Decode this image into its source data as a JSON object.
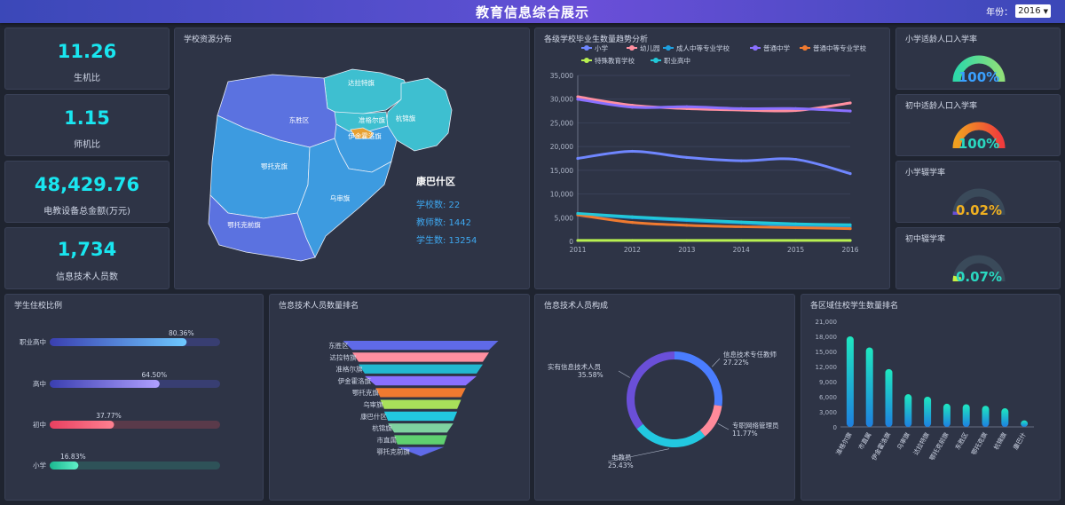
{
  "header": {
    "title": "教育信息综合展示",
    "year_label": "年份：",
    "year_value": "2016"
  },
  "kpis": [
    {
      "value": "11.26",
      "label": "生机比"
    },
    {
      "value": "1.15",
      "label": "师机比"
    },
    {
      "value": "48,429.76",
      "label": "电教设备总金额(万元)"
    },
    {
      "value": "1,734",
      "label": "信息技术人员数"
    }
  ],
  "map": {
    "title": "学校资源分布",
    "regions": [
      "达拉特旗",
      "杭锦旗",
      "东胜区",
      "准格尔旗",
      "伊金霍洛旗",
      "鄂托克旗",
      "乌审旗",
      "鄂托克前旗"
    ],
    "selected": {
      "name": "康巴什区",
      "schools": "学校数: 22",
      "teachers": "教师数: 1442",
      "students": "学生数: 13254"
    },
    "colors": {
      "light": "#3ebfd0",
      "mid": "#3d9be0",
      "dark": "#5b72e0",
      "selected": "#e8a030"
    }
  },
  "gauges": [
    {
      "title": "小学适龄人口入学率",
      "value": "100%",
      "fraction": 1.0,
      "color_start": "#2ed8a8",
      "color_end": "#8fe07a",
      "text_color": "#3aa0ff"
    },
    {
      "title": "初中适龄人口入学率",
      "value": "100%",
      "fraction": 1.0,
      "color_start": "#f0a020",
      "color_end": "#f03c3c",
      "text_color": "#2ad8c0"
    },
    {
      "title": "小学辍学率",
      "value": "0.02%",
      "fraction": 0.02,
      "color_start": "#6a4fd8",
      "color_end": "#6a4fd8",
      "text_color": "#f0b020"
    },
    {
      "title": "初中辍学率",
      "value": "0.07%",
      "fraction": 0.07,
      "color_start": "#c8f040",
      "color_end": "#c8f040",
      "text_color": "#2ad8c0"
    }
  ],
  "chart_data": [
    {
      "type": "line",
      "title": "各级学校毕业生数量趋势分析",
      "x": [
        "2011",
        "2012",
        "2013",
        "2014",
        "2015",
        "2016"
      ],
      "ylim": [
        0,
        35000
      ],
      "yticks": [
        "0",
        "5,000",
        "10,000",
        "15,000",
        "20,000",
        "25,000",
        "30,000",
        "35,000"
      ],
      "series": [
        {
          "name": "小学",
          "color": "#6f86ff",
          "values": [
            17500,
            19000,
            17700,
            17000,
            17300,
            14300
          ]
        },
        {
          "name": "幼儿园",
          "color": "#ff8fa0",
          "values": [
            30500,
            28700,
            28000,
            27700,
            27600,
            29200
          ]
        },
        {
          "name": "成人中等专业学校",
          "color": "#1ea0e0",
          "values": [
            5800,
            5000,
            4400,
            3900,
            3300,
            3100
          ]
        },
        {
          "name": "普通中学",
          "color": "#8a70ff",
          "values": [
            30000,
            28300,
            28400,
            28000,
            28000,
            27500
          ]
        },
        {
          "name": "普通中等专业学校",
          "color": "#f07a30",
          "values": [
            5600,
            4000,
            3400,
            3100,
            2900,
            2700
          ]
        },
        {
          "name": "特殊教育学校",
          "color": "#b8f050",
          "values": [
            200,
            200,
            200,
            200,
            200,
            200
          ]
        },
        {
          "name": "职业高中",
          "color": "#22c8d8",
          "values": [
            5900,
            5200,
            4600,
            4100,
            3700,
            3500
          ]
        }
      ]
    },
    {
      "type": "bar",
      "title": "学生住校比例",
      "categories": [
        "职业高中",
        "高中",
        "初中",
        "小学"
      ],
      "values": [
        80.36,
        64.5,
        37.77,
        16.83
      ],
      "labels": [
        "80.36%",
        "64.50%",
        "37.77%",
        "16.83%"
      ],
      "colors": [
        [
          "#3a3fb0",
          "#6ec8ff"
        ],
        [
          "#3a3fb0",
          "#b0a0ff"
        ],
        [
          "#e84060",
          "#ff8090"
        ],
        [
          "#1ab890",
          "#60f0c8"
        ]
      ],
      "track_colors": [
        "#383e72",
        "#383e72",
        "#5a3a4a",
        "#2e5258"
      ]
    },
    {
      "type": "bar",
      "title": "信息技术人员数量排名",
      "categories": [
        "东胜区",
        "达拉特旗",
        "准格尔旗",
        "伊金霍洛旗",
        "鄂托克旗",
        "乌审旗",
        "康巴什区",
        "杭锦旗",
        "市直属",
        "鄂托克前旗"
      ],
      "values": [
        100,
        88,
        80,
        72,
        58,
        52,
        47,
        42,
        34,
        30
      ],
      "colors": [
        "#5f6ae8",
        "#ff8fa0",
        "#22b8d0",
        "#8a70ff",
        "#f07a30",
        "#a8e05a",
        "#22c8e0",
        "#7fd2a0",
        "#5fd070",
        "#5f6ae8"
      ]
    },
    {
      "type": "pie",
      "title": "信息技术人员构成",
      "slices": [
        {
          "name": "信息技术专任教师",
          "value": 27.22,
          "label": "27.22%",
          "color": "#4a7dff"
        },
        {
          "name": "专职网络管理员",
          "value": 11.77,
          "label": "11.77%",
          "color": "#ff8a9a"
        },
        {
          "name": "电教员",
          "value": 25.43,
          "label": "25.43%",
          "color": "#22c8e0"
        },
        {
          "name": "实有信息技术人员",
          "value": 35.58,
          "label": "35.58%",
          "color": "#6a4fd8"
        }
      ]
    },
    {
      "type": "bar",
      "title": "各区域住校学生数量排名",
      "categories": [
        "准格尔旗",
        "市直属",
        "伊金霍洛旗",
        "乌审旗",
        "达拉特旗",
        "鄂托克前旗",
        "东胜区",
        "鄂托克旗",
        "杭锦旗",
        "康巴什"
      ],
      "values": [
        18000,
        15800,
        11500,
        6500,
        6000,
        4600,
        4500,
        4200,
        3700,
        1300
      ],
      "ylim": [
        0,
        21000
      ],
      "yticks": [
        "0",
        "3,000",
        "6,000",
        "9,000",
        "12,000",
        "15,000",
        "18,000",
        "21,000"
      ],
      "color_top": "#1ee8c0",
      "color_bottom": "#1e80e0"
    }
  ]
}
